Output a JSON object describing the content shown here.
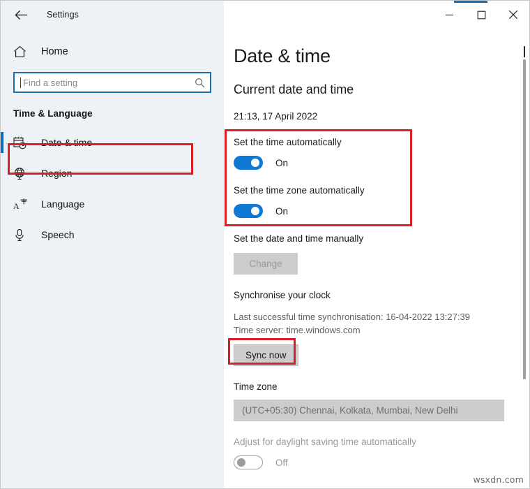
{
  "window": {
    "title": "Settings",
    "back_icon": "back-arrow-icon",
    "minimize_icon": "minimize-icon",
    "maximize_icon": "maximize-icon",
    "close_icon": "close-icon",
    "accent_color": "#1b6ca8"
  },
  "sidebar": {
    "home": {
      "label": "Home",
      "icon": "home-icon"
    },
    "search": {
      "value": "",
      "placeholder": "Find a setting",
      "icon": "search-icon",
      "focus_color": "#1a6fae"
    },
    "section_title": "Time & Language",
    "items": [
      {
        "label": "Date & time",
        "icon": "calendar-clock-icon",
        "selected": true
      },
      {
        "label": "Region",
        "icon": "globe-icon",
        "selected": false
      },
      {
        "label": "Language",
        "icon": "language-icon",
        "selected": false
      },
      {
        "label": "Speech",
        "icon": "microphone-icon",
        "selected": false
      }
    ],
    "selection_color": "#0e6ebd"
  },
  "main": {
    "page_title": "Date & time",
    "current_group_heading": "Current date and time",
    "current_datetime": "21:13, 17 April 2022",
    "set_time_auto": {
      "label": "Set the time automatically",
      "state": "On",
      "on": true
    },
    "set_timezone_auto": {
      "label": "Set the time zone automatically",
      "state": "On",
      "on": true
    },
    "manual": {
      "label": "Set the date and time manually",
      "button_label": "Change",
      "button_enabled": false
    },
    "sync": {
      "heading": "Synchronise your clock",
      "last_sync": "Last successful time synchronisation: 16-04-2022 13:27:39",
      "time_server": "Time server: time.windows.com",
      "button_label": "Sync now"
    },
    "timezone": {
      "heading": "Time zone",
      "selected": "(UTC+05:30) Chennai, Kolkata, Mumbai, New Delhi"
    },
    "dst": {
      "label": "Adjust for daylight saving time automatically",
      "state": "Off",
      "on": false
    }
  },
  "annotations": {
    "highlight_color": "#d81f26",
    "boxes": [
      "sidebar-date-time-item",
      "auto-time-toggles",
      "sync-now-button"
    ]
  },
  "watermark": "wsxdn.com"
}
